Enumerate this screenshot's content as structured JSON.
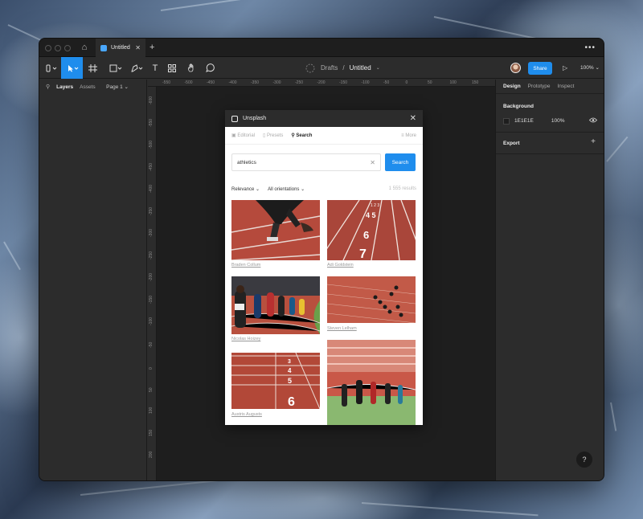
{
  "window": {
    "tab_title": "Untitled",
    "more_glyph": "•••"
  },
  "toolbar": {
    "breadcrumb_root": "Drafts",
    "breadcrumb_sep": "/",
    "file_name": "Untitled",
    "share_label": "Share",
    "zoom_label": "100%"
  },
  "left_panel": {
    "tabs": [
      "Layers",
      "Assets"
    ],
    "page_label": "Page 1"
  },
  "rulers": {
    "horizontal": [
      "-550",
      "-500",
      "-450",
      "-400",
      "-350",
      "-300",
      "-250",
      "-200",
      "-150",
      "-100",
      "-50",
      "0",
      "50",
      "100",
      "150"
    ],
    "vertical": [
      "-600",
      "-550",
      "-500",
      "-450",
      "-400",
      "-350",
      "-300",
      "-250",
      "-200",
      "-150",
      "-100",
      "-50",
      "0",
      "50",
      "100",
      "150",
      "200"
    ]
  },
  "right_panel": {
    "tabs": [
      "Design",
      "Prototype",
      "Inspect"
    ],
    "background_title": "Background",
    "bg_hex": "1E1E1E",
    "bg_opacity": "100%",
    "export_title": "Export",
    "help_label": "?"
  },
  "plugin": {
    "title": "Unsplash",
    "nav": {
      "editorial": "Editorial",
      "presets": "Presets",
      "search": "Search",
      "more": "More"
    },
    "search_value": "athletics",
    "search_button": "Search",
    "filter_sort": "Relevance",
    "filter_orientation": "All orientations",
    "results_count": "1 555 results",
    "credits": {
      "c1": "Braden Collum",
      "c2": "Adi Goldstein",
      "c3": "Nicolas Hoizey",
      "c4": "Steven Lelham",
      "c5": "Austris Augusts"
    }
  },
  "colors": {
    "accent": "#1f8ded",
    "canvas_bg": "#1e1e1e",
    "panel_bg": "#2c2c2c",
    "track_red": "#b4463a"
  }
}
